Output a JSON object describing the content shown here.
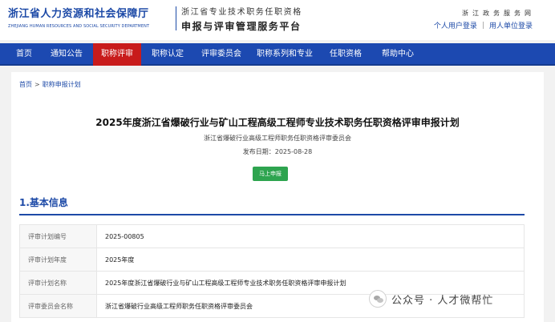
{
  "header": {
    "logo_cn": "浙江省人力资源和社会保障厅",
    "logo_en": "ZHEJIANG HUMAN RESOURCES AND SOCIAL SECURITY DEPARTMENT",
    "platform_line1": "浙江省专业技术职务任职资格",
    "platform_line2": "申报与评审管理服务平台",
    "site_chars": [
      "浙",
      "江",
      "政",
      "务",
      "服",
      "务",
      "网"
    ],
    "personal_login": "个人用户登录",
    "divider": "|",
    "unit_login": "用人单位登录"
  },
  "nav": {
    "items": [
      {
        "label": "首页"
      },
      {
        "label": "通知公告"
      },
      {
        "label": "职称评审"
      },
      {
        "label": "职称认定"
      },
      {
        "label": "评审委员会"
      },
      {
        "label": "职称系列和专业"
      },
      {
        "label": "任职资格"
      },
      {
        "label": "帮助中心"
      }
    ],
    "active_index": 2
  },
  "breadcrumb": {
    "home": "首页",
    "separator": ">",
    "current": "职称申报计划"
  },
  "plan": {
    "title": "2025年度浙江省爆破行业与矿山工程高级工程师专业技术职务任职资格评审申报计划",
    "committee": "浙江省爆破行业高级工程师职务任职资格评审委员会",
    "publish_date": "发布日期：2025-08-28",
    "apply_button": "马上申报"
  },
  "section": {
    "title": "1.基本信息"
  },
  "info_rows": [
    {
      "label": "评审计划编号",
      "value": "2025-00805"
    },
    {
      "label": "评审计划年度",
      "value": "2025年度"
    },
    {
      "label": "评审计划名称",
      "value": "2025年度浙江省爆破行业与矿山工程高级工程师专业技术职务任职资格评审申报计划"
    },
    {
      "label": "评审委员会名称",
      "value": "浙江省爆破行业高级工程师职务任职资格评审委员会"
    }
  ],
  "watermark": {
    "text": "公众号 · 人才微帮忙",
    "icon": "wechat-icon"
  },
  "colors": {
    "brand_blue": "#1c49b1",
    "active_red": "#c81b1b",
    "button_green": "#2ea44f"
  }
}
